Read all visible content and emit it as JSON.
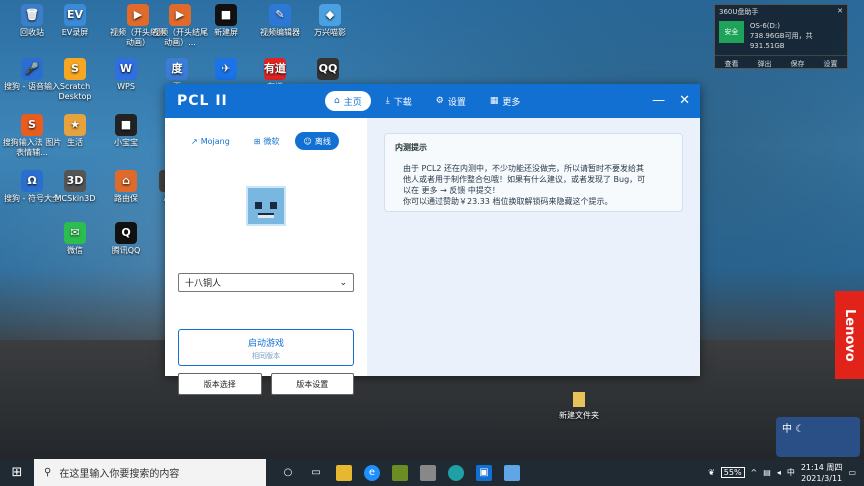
{
  "desktop": {
    "icons": [
      {
        "label": "回收站",
        "x": "0",
        "color": "#3c7ec8",
        "glyph": "🗑"
      },
      {
        "label": "EV录屏",
        "color": "#3c8ad6",
        "glyph": "EV"
      },
      {
        "label": "视频（开头结尾动画）",
        "color": "#e06a2b",
        "glyph": "▶"
      },
      {
        "label": "视频（开头结尾动画）...",
        "color": "#e06a2b",
        "glyph": "▶"
      },
      {
        "label": "新建屏",
        "color": "#111",
        "glyph": "■"
      },
      {
        "label": "视频编辑器",
        "color": "#2c78d6",
        "glyph": "✎"
      },
      {
        "label": "万兴喵影",
        "color": "#4aa0e0",
        "glyph": "◆"
      },
      {
        "label": "搜狗 - 语音输入",
        "color": "#2a6fd0",
        "glyph": "🎤"
      },
      {
        "label": "Scratch Desktop",
        "color": "#f5a623",
        "glyph": "S"
      },
      {
        "label": "WPS",
        "color": "#2f6fe0",
        "glyph": "W"
      },
      {
        "label": "百",
        "color": "#3a7dd8",
        "glyph": "度"
      },
      {
        "label": "",
        "color": "#1a73e8",
        "glyph": "✈"
      },
      {
        "label": "有道",
        "color": "#e02424",
        "glyph": "有道"
      },
      {
        "label": "",
        "color": "#333",
        "glyph": "QQ"
      },
      {
        "label": "搜狗输入法 图片表情辅...",
        "color": "#e85d1f",
        "glyph": "S"
      },
      {
        "label": "生活",
        "color": "#e6a23c",
        "glyph": "★"
      },
      {
        "label": "小宝宝",
        "color": "#222",
        "glyph": "■"
      },
      {
        "label": "搜狗 - 符号大全",
        "color": "#2a6fd0",
        "glyph": "Ω"
      },
      {
        "label": "MCSkin3D",
        "color": "#555",
        "glyph": "3D"
      },
      {
        "label": "路由保",
        "color": "#e06a2b",
        "glyph": "⌂"
      },
      {
        "label": "Alp",
        "color": "#444",
        "glyph": "A"
      },
      {
        "label": "微信",
        "color": "#2bbd4d",
        "glyph": "✉"
      },
      {
        "label": "腾讯QQ",
        "color": "#111",
        "glyph": "Q"
      }
    ],
    "folder_label": "新建文件夹",
    "lenovo": "Lenovo",
    "avatar_badge": "01:45"
  },
  "widget360": {
    "title": "360U盘助手",
    "drive": "OS-6(D:)",
    "safe": "安全",
    "free": "738.96GB可用，共931.51GB",
    "tools": [
      "查看",
      "弹出",
      "保存",
      "设置"
    ]
  },
  "pcl": {
    "title": "PCL II",
    "tabs": [
      {
        "label": "主页",
        "icon": "home-icon",
        "active": true
      },
      {
        "label": "下载",
        "icon": "download-icon",
        "active": false
      },
      {
        "label": "设置",
        "icon": "gear-icon",
        "active": false
      },
      {
        "label": "更多",
        "icon": "grid-icon",
        "active": false
      }
    ],
    "account_tabs": [
      {
        "label": "Mojang",
        "active": false
      },
      {
        "label": "微软",
        "active": false
      },
      {
        "label": "离线",
        "active": true
      }
    ],
    "player_name": "十八铜人",
    "launch_label": "启动游戏",
    "launch_sub": "相同版本",
    "version_select": "版本选择",
    "version_settings": "版本设置",
    "notice_title": "内测提示",
    "notice_lines": [
      "由于 PCL2 还在内测中，不少功能还没做完，所以请暂时不要发给其",
      "他人或者用于制作整合包哦！如果有什么建议，或者发现了 Bug，可",
      "以在 更多 → 反馈 中提交！",
      "你可以通过赞助￥23.33 档位换取解锁码来隐藏这个提示。"
    ]
  },
  "taskbar": {
    "search_placeholder": "在这里输入你要搜索的内容",
    "battery": "55%",
    "ime": "中",
    "time": "21:14 周四",
    "date": "2021/3/11"
  },
  "ime_box": {
    "label": "中"
  }
}
